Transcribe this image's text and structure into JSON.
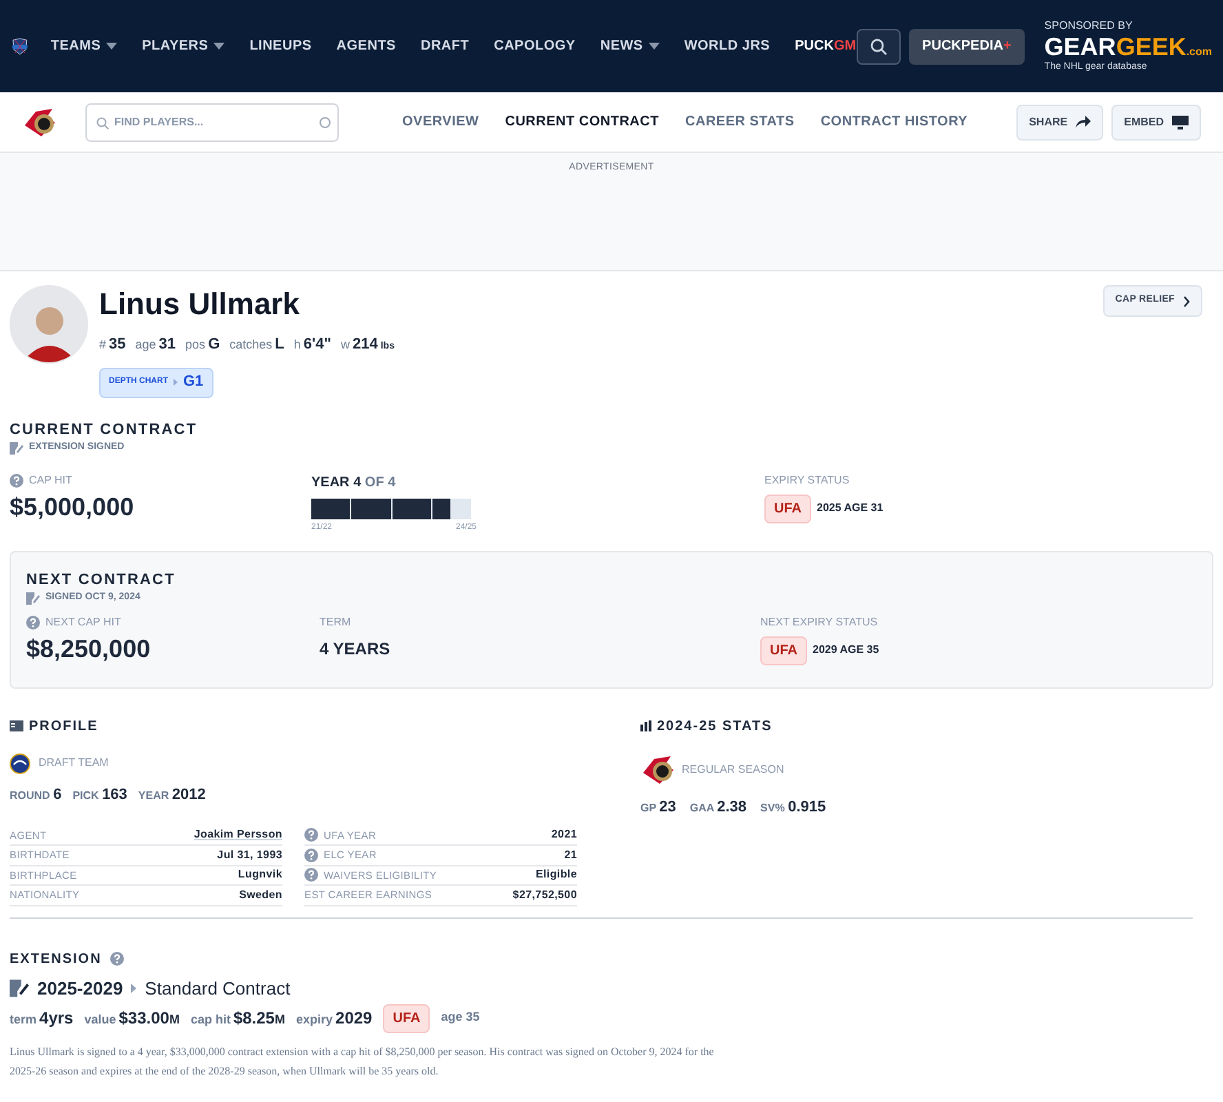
{
  "top_nav": {
    "items": [
      {
        "label": "TEAMS",
        "has_menu": true
      },
      {
        "label": "PLAYERS",
        "has_menu": true
      },
      {
        "label": "LINEUPS",
        "has_menu": false
      },
      {
        "label": "AGENTS",
        "has_menu": false
      },
      {
        "label": "DRAFT",
        "has_menu": false
      },
      {
        "label": "CAPOLOGY",
        "has_menu": false
      },
      {
        "label": "NEWS",
        "has_menu": true
      },
      {
        "label": "WORLD JRS",
        "has_menu": false
      }
    ],
    "puck_gm": {
      "label": "PUCK",
      "accent": "GM"
    },
    "plus_button": {
      "label": "PUCKPEDIA",
      "accent": "+"
    },
    "sponsor": {
      "caption": "SPONSORED BY",
      "logo_main": "GEAR",
      "logo_accent": "GEEK",
      "logo_suffix": ".com",
      "tagline": "The NHL gear database"
    }
  },
  "sub_nav": {
    "search": {
      "placeholder": "FIND PLAYERS..."
    },
    "tabs": [
      {
        "label": "OVERVIEW",
        "selected": false
      },
      {
        "label": "CURRENT CONTRACT",
        "selected": true
      },
      {
        "label": "CAREER STATS",
        "selected": false
      },
      {
        "label": "CONTRACT HISTORY",
        "selected": false
      }
    ],
    "actions": [
      "SHARE",
      "EMBED"
    ]
  },
  "advertisement": "ADVERTISEMENT",
  "player": {
    "name": "Linus Ullmark",
    "facts": [
      {
        "label": "#",
        "value": "35"
      },
      {
        "label": "age",
        "value": "31"
      },
      {
        "label": "pos",
        "value": "G"
      },
      {
        "label": "catches",
        "value": "L"
      },
      {
        "label": "h",
        "value": "6'4\""
      },
      {
        "label": "w",
        "value": "214",
        "unit": "lbs"
      }
    ],
    "depth_chart": {
      "label": "DEPTH CHART",
      "value": "G1"
    },
    "cap_relief": "CAP RELIEF"
  },
  "current_contract": {
    "title": "CURRENT CONTRACT",
    "note": "EXTENSION SIGNED",
    "cap_hit_label": "CAP HIT",
    "cap_hit": "$5,000,000",
    "year_label": "YEAR",
    "year": "4",
    "of_label": "OF",
    "of": "4",
    "level": 0.87,
    "start": "21/22",
    "end": "24/25",
    "expiry_label": "EXPIRY STATUS",
    "expiry_badge": "UFA",
    "expiry_text": "2025 AGE 31"
  },
  "next_contract": {
    "title": "NEXT CONTRACT",
    "note": "SIGNED OCT 9, 2024",
    "cap_hit_label": "NEXT CAP HIT",
    "cap_hit": "$8,250,000",
    "term_label": "TERM",
    "term": "4 YEARS",
    "expiry_label": "NEXT EXPIRY STATUS",
    "expiry_badge": "UFA",
    "expiry_text": "2029 AGE 35"
  },
  "profile": {
    "title": "PROFILE",
    "draft_label": "DRAFT TEAM",
    "draft": [
      {
        "label": "ROUND",
        "value": "6"
      },
      {
        "label": "PICK",
        "value": "163"
      },
      {
        "label": "YEAR",
        "value": "2012"
      }
    ],
    "left_rows": [
      {
        "label": "AGENT",
        "value": "Joakim Persson",
        "link": true
      },
      {
        "label": "BIRTHDATE",
        "value": "Jul 31, 1993",
        "link": false
      },
      {
        "label": "BIRTHPLACE",
        "value": "Lugnvik",
        "link": false
      },
      {
        "label": "NATIONALITY",
        "value": "Sweden",
        "link": false
      }
    ],
    "right_rows": [
      {
        "label": "UFA YEAR",
        "value": "2021",
        "help": true
      },
      {
        "label": "ELC YEAR",
        "value": "21",
        "help": true
      },
      {
        "label": "WAIVERS ELIGIBILITY",
        "value": "Eligible",
        "help": true
      },
      {
        "label": "EST CAREER EARNINGS",
        "value": "$27,752,500",
        "help": false
      }
    ]
  },
  "stats": {
    "title": "2024-25 STATS",
    "season": "REGULAR SEASON",
    "items": [
      {
        "label": "GP",
        "value": "23"
      },
      {
        "label": "GAA",
        "value": "2.38"
      },
      {
        "label": "SV%",
        "value": "0.915"
      }
    ]
  },
  "extension": {
    "title": "EXTENSION",
    "years": "2025-2029",
    "type": "Standard Contract",
    "terms": [
      {
        "label": "term",
        "value": "4yrs"
      },
      {
        "label": "value",
        "value": "$33.00",
        "unit": "M"
      },
      {
        "label": "cap hit",
        "value": "$8.25",
        "unit": "M"
      },
      {
        "label": "expiry",
        "value": "2029"
      }
    ],
    "badge": "UFA",
    "age": "age 35",
    "summary": "Linus Ullmark is signed to a 4 year, $33,000,000 contract extension with a cap hit of $8,250,000 per season. His contract was signed on October 9, 2024 for the 2025-26 season and expires at the end of the 2028-29 season, when Ullmark will be 35 years old."
  }
}
